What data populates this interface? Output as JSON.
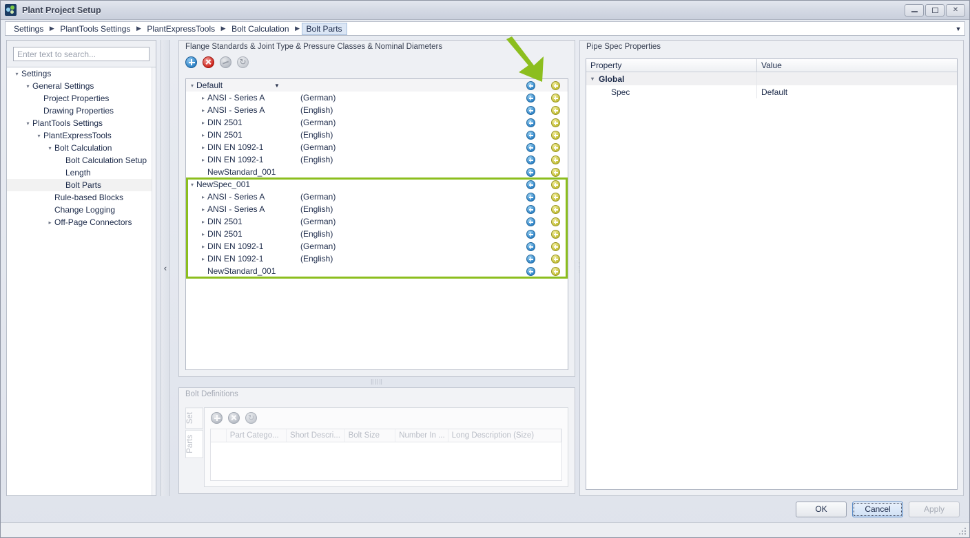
{
  "window": {
    "title": "Plant Project Setup",
    "icon": "app-icon",
    "minimize": "–",
    "maximize": "□",
    "close": "✕"
  },
  "breadcrumb": {
    "items": [
      "Settings",
      "PlantTools Settings",
      "PlantExpressTools",
      "Bolt Calculation",
      "Bolt Parts"
    ],
    "active_index": 4,
    "separator": "▶",
    "dropdown": "▼"
  },
  "sidebar": {
    "search": {
      "placeholder": "Enter text to search...",
      "value": ""
    },
    "items": [
      {
        "label": "Settings",
        "depth": 0,
        "arrow": "▾",
        "selected": false
      },
      {
        "label": "General Settings",
        "depth": 1,
        "arrow": "▾",
        "selected": false
      },
      {
        "label": "Project Properties",
        "depth": 2,
        "arrow": "",
        "selected": false
      },
      {
        "label": "Drawing Properties",
        "depth": 2,
        "arrow": "",
        "selected": false
      },
      {
        "label": "PlantTools Settings",
        "depth": 1,
        "arrow": "▾",
        "selected": false
      },
      {
        "label": "PlantExpressTools",
        "depth": 2,
        "arrow": "▾",
        "selected": false
      },
      {
        "label": "Bolt Calculation",
        "depth": 3,
        "arrow": "▾",
        "selected": false
      },
      {
        "label": "Bolt Calculation Setup",
        "depth": 4,
        "arrow": "",
        "selected": false
      },
      {
        "label": "Length",
        "depth": 4,
        "arrow": "",
        "selected": false
      },
      {
        "label": "Bolt Parts",
        "depth": 4,
        "arrow": "",
        "selected": true
      },
      {
        "label": "Rule-based Blocks",
        "depth": 3,
        "arrow": "",
        "selected": false
      },
      {
        "label": "Change Logging",
        "depth": 3,
        "arrow": "",
        "selected": false
      },
      {
        "label": "Off-Page Connectors",
        "depth": 3,
        "arrow": "▸",
        "selected": false
      }
    ],
    "collapse_handle": "‹"
  },
  "flange_panel": {
    "title": "Flange Standards & Joint Type & Pressure Classes & Nominal Diameters",
    "toolbar": [
      {
        "name": "add-icon",
        "style": "blue",
        "glyph": "+",
        "enabled": true
      },
      {
        "name": "delete-icon",
        "style": "red",
        "glyph": "✕",
        "enabled": true
      },
      {
        "name": "hide-icon",
        "style": "gray",
        "glyph": "",
        "enabled": false
      },
      {
        "name": "refresh-icon",
        "style": "gray2",
        "glyph": "↺",
        "enabled": false
      }
    ],
    "rows": [
      {
        "label": "Default",
        "lang": "",
        "depth": 0,
        "arrow": "▾",
        "dropdown": "▼",
        "header": true,
        "highlight": false
      },
      {
        "label": "ANSI - Series A",
        "lang": "(German)",
        "depth": 1,
        "arrow": "▸",
        "dropdown": "",
        "header": false,
        "highlight": false
      },
      {
        "label": "ANSI - Series A",
        "lang": "(English)",
        "depth": 1,
        "arrow": "▸",
        "dropdown": "",
        "header": false,
        "highlight": false
      },
      {
        "label": "DIN 2501",
        "lang": "(German)",
        "depth": 1,
        "arrow": "▸",
        "dropdown": "",
        "header": false,
        "highlight": false
      },
      {
        "label": "DIN 2501",
        "lang": "(English)",
        "depth": 1,
        "arrow": "▸",
        "dropdown": "",
        "header": false,
        "highlight": false
      },
      {
        "label": "DIN EN 1092-1",
        "lang": "(German)",
        "depth": 1,
        "arrow": "▸",
        "dropdown": "",
        "header": false,
        "highlight": false
      },
      {
        "label": "DIN EN 1092-1",
        "lang": "(English)",
        "depth": 1,
        "arrow": "▸",
        "dropdown": "",
        "header": false,
        "highlight": false
      },
      {
        "label": "NewStandard_001",
        "lang": "",
        "depth": 1,
        "arrow": "",
        "dropdown": "",
        "header": false,
        "highlight": false
      },
      {
        "label": "NewSpec_001",
        "lang": "",
        "depth": 0,
        "arrow": "▾",
        "dropdown": "",
        "header": false,
        "highlight": true
      },
      {
        "label": "ANSI - Series A",
        "lang": "(German)",
        "depth": 1,
        "arrow": "▸",
        "dropdown": "",
        "header": false,
        "highlight": true
      },
      {
        "label": "ANSI - Series A",
        "lang": "(English)",
        "depth": 1,
        "arrow": "▸",
        "dropdown": "",
        "header": false,
        "highlight": true
      },
      {
        "label": "DIN 2501",
        "lang": "(German)",
        "depth": 1,
        "arrow": "▸",
        "dropdown": "",
        "header": false,
        "highlight": true
      },
      {
        "label": "DIN 2501",
        "lang": "(English)",
        "depth": 1,
        "arrow": "▸",
        "dropdown": "",
        "header": false,
        "highlight": true
      },
      {
        "label": "DIN EN 1092-1",
        "lang": "(German)",
        "depth": 1,
        "arrow": "▸",
        "dropdown": "",
        "header": false,
        "highlight": true
      },
      {
        "label": "DIN EN 1092-1",
        "lang": "(English)",
        "depth": 1,
        "arrow": "▸",
        "dropdown": "",
        "header": false,
        "highlight": true
      },
      {
        "label": "NewStandard_001",
        "lang": "",
        "depth": 1,
        "arrow": "",
        "dropdown": "",
        "header": false,
        "highlight": true
      }
    ],
    "row_icons": {
      "blue": "add-child-icon",
      "yellow": "add-sibling-icon"
    },
    "highlight_color": "#8cbe1e"
  },
  "annotation": {
    "arrow_color": "#8cbe1e",
    "points_to": "add-sibling-icon"
  },
  "bolt_definitions": {
    "title": "Bolt Definitions",
    "enabled": false,
    "tabs": [
      "Set",
      "Parts"
    ],
    "active_tab": "Parts",
    "toolbar": [
      {
        "name": "add-icon",
        "glyph": "+"
      },
      {
        "name": "delete-icon",
        "glyph": "✕"
      },
      {
        "name": "refresh-icon",
        "glyph": "↺"
      }
    ],
    "columns": [
      "Part Catego...",
      "Short Descri...",
      "Bolt Size",
      "Number In ...",
      "Long Description (Size)"
    ],
    "rows": []
  },
  "pipe_spec": {
    "title": "Pipe Spec  Properties",
    "columns": [
      "Property",
      "Value"
    ],
    "rows": [
      {
        "property": "Global",
        "value": "",
        "group": true,
        "arrow": "▾"
      },
      {
        "property": "Spec",
        "value": "Default",
        "group": false,
        "arrow": ""
      }
    ]
  },
  "footer": {
    "ok": "OK",
    "cancel": "Cancel",
    "apply": "Apply"
  }
}
